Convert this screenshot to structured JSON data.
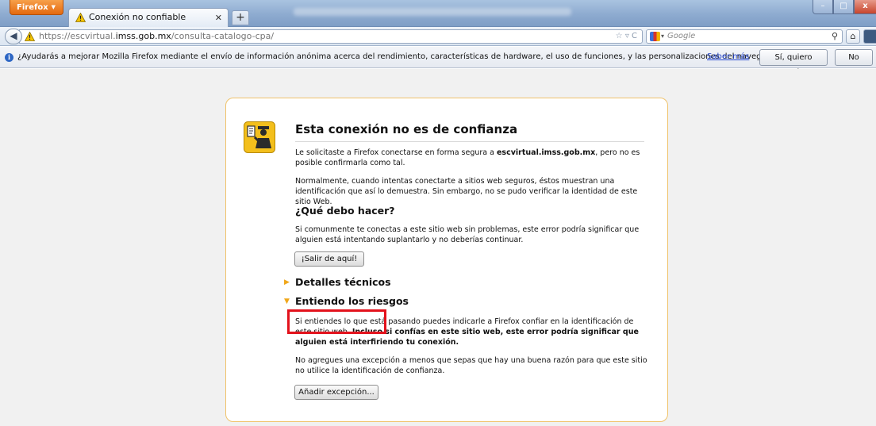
{
  "browser": {
    "menu_button": "Firefox",
    "tab_title": "Conexión no confiable",
    "new_tab": "+",
    "window_controls": {
      "min": "–",
      "max": "□",
      "close": "x"
    }
  },
  "nav": {
    "url_prefix": "https://escvirtual.",
    "url_host": "imss.gob.mx",
    "url_path": "/consulta-catalogo-cpa/",
    "url_right_glyphs": "☆ ▿ C",
    "search_placeholder": "Google"
  },
  "notification": {
    "message": "¿Ayudarás a mejorar Mozilla Firefox mediante el envío de información anónima acerca del rendimiento, características de hardware, el uso de funciones, y las personalizaciones del navegador a Mozilla?",
    "link": "Saber más",
    "yes_button": "Sí, quiero ayudar",
    "no_button": "No"
  },
  "error_page": {
    "title": "Esta conexión no es de confianza",
    "p1_before": "Le solicitaste a Firefox conectarse en forma segura a ",
    "p1_host": "escvirtual.imss.gob.mx",
    "p1_after": ", pero no es posible confirmarla como tal.",
    "p2": "Normalmente, cuando intentas conectarte a sitios web seguros, éstos muestran una identificación que así lo demuestra. Sin embargo, no se pudo verificar la identidad de este sitio Web.",
    "what_heading": "¿Qué debo hacer?",
    "p3": "Si comunmente te conectas a este sitio web sin problemas, este error podría significar que alguien está intentando suplantarlo y no deberías continuar.",
    "leave_button": "¡Salir de aquí!",
    "tech_heading": "Detalles técnicos",
    "risk_heading": "Entiendo los riesgos",
    "p4_normal": "Si entiendes lo que está pasando puedes indicarle a Firefox confiar en la identificación de este sitio web.",
    "p4_bold": "Incluso si confías en este sitio web, este error podría significar que alguien está interfiriendo tu conexión.",
    "p5": "No agregues una excepción a menos que sepas que hay una buena razón para que este sitio no utilice la identificación de confianza.",
    "exception_button": "Añadir excepción..."
  },
  "colors": {
    "highlight": "#e3121c",
    "box_border": "#f0c36b",
    "arrow": "#f0a71a",
    "firefox_orange": "#e4690f"
  }
}
